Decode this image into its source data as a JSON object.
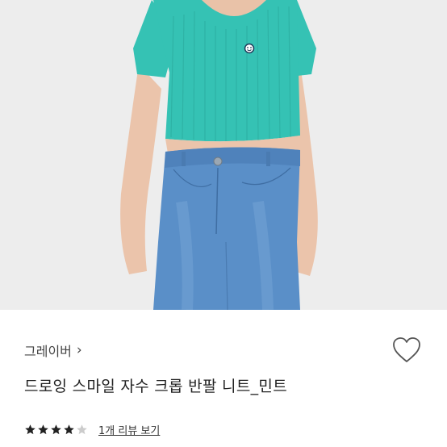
{
  "product": {
    "image_alt": "",
    "brand": "그레이버",
    "title": "드로잉 스마일 자수 크롭 반팔 니트_민트",
    "rating_stars": 4,
    "rating_max": 5,
    "review_link": "1개 리뷰 보기"
  },
  "icons": {
    "brand_arrow": "chevron-right-icon",
    "wishlist": "heart-outline-icon",
    "star": "star-icon"
  },
  "colors": {
    "knit": "#35c2b4",
    "denim": "#5a8fc8",
    "star_filled": "#222222",
    "star_empty": "#cccccc"
  }
}
